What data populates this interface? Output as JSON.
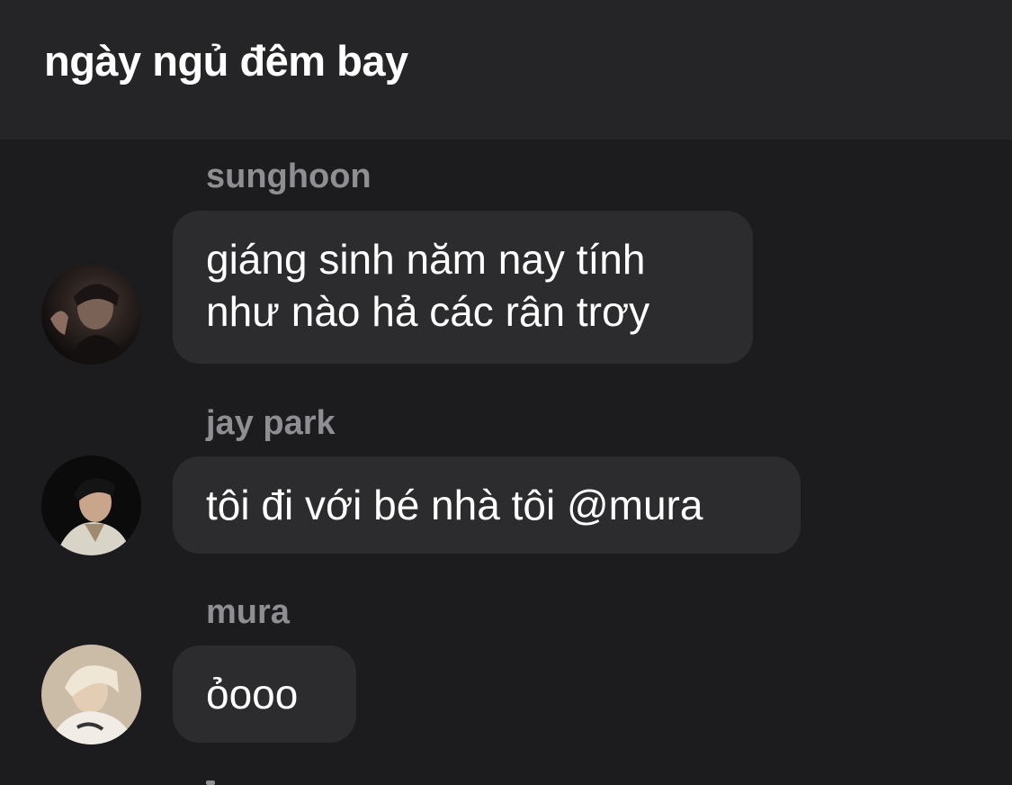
{
  "header": {
    "title": "ngày ngủ đêm bay"
  },
  "messages": [
    {
      "sender": "sunghoon",
      "lines": [
        "giáng sinh năm nay tính",
        "như nào hả các rân trơy"
      ],
      "avatar_icon": "profile-photo-sunghoon"
    },
    {
      "sender": "jay park",
      "lines": [
        "tôi đi với bé nhà tôi @mura"
      ],
      "avatar_icon": "profile-photo-jay-park"
    },
    {
      "sender": "mura",
      "lines": [
        "ỏooo"
      ],
      "avatar_icon": "profile-photo-mura"
    }
  ],
  "colors": {
    "background": "#1c1c1e",
    "header": "#252527",
    "bubble": "#2c2c2e",
    "sender_name": "#8e8e93",
    "text": "#ffffff"
  }
}
